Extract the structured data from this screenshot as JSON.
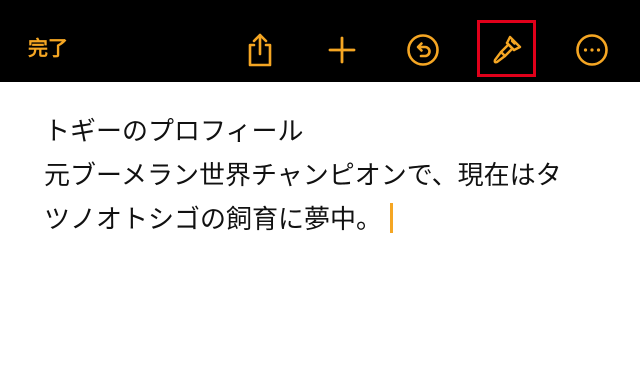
{
  "toolbar": {
    "done_label": "完了",
    "share_icon": "share-icon",
    "add_icon": "plus-icon",
    "undo_icon": "undo-icon",
    "format_icon": "paintbrush-icon",
    "more_icon": "ellipsis-circle-icon",
    "accent_color": "#f5a623",
    "background_color": "#000000",
    "highlight_color": "#e0001a"
  },
  "note": {
    "lines": [
      "トギーのプロフィール",
      "元ブーメラン世界チャンピオンで、現在はタ",
      "ツノオトシゴの飼育に夢中。"
    ]
  }
}
